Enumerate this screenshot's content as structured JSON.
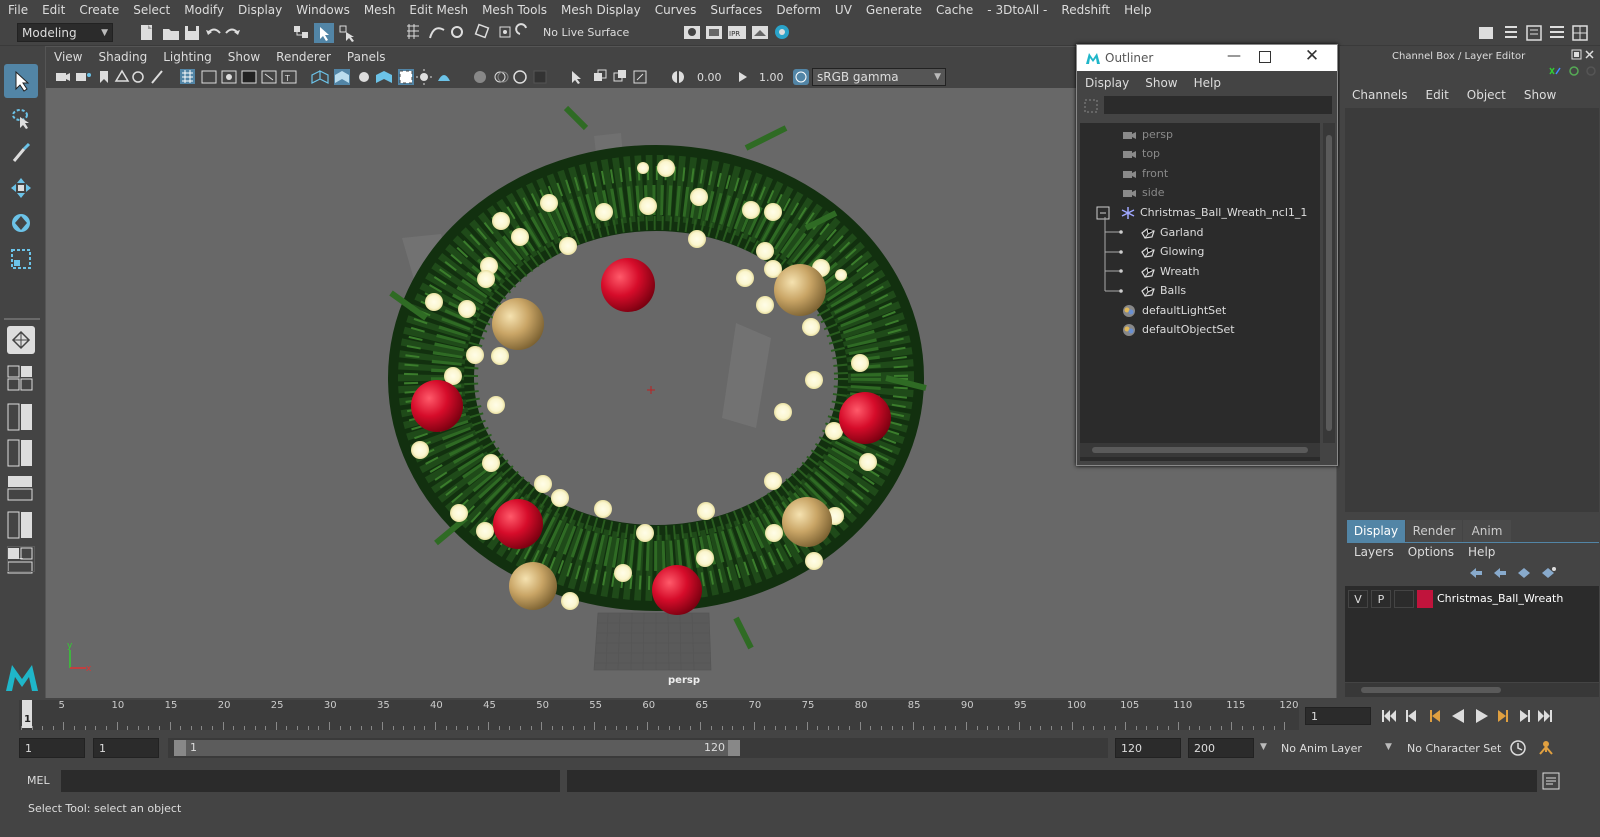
{
  "menu": [
    "File",
    "Edit",
    "Create",
    "Select",
    "Modify",
    "Display",
    "Windows",
    "Mesh",
    "Edit Mesh",
    "Mesh Tools",
    "Mesh Display",
    "Curves",
    "Surfaces",
    "Deform",
    "UV",
    "Generate",
    "Cache",
    "- 3DtoAll -",
    "Redshift",
    "Help"
  ],
  "status": {
    "workspace": "Modeling",
    "live_surface": "No Live Surface"
  },
  "viewport": {
    "menu": [
      "View",
      "Shading",
      "Lighting",
      "Show",
      "Renderer",
      "Panels"
    ],
    "exposure": "0.00",
    "gamma": "1.00",
    "colorspace": "sRGB gamma",
    "camera_label": "persp"
  },
  "outliner": {
    "title": "Outliner",
    "menu": [
      "Display",
      "Show",
      "Help"
    ],
    "items": [
      {
        "label": "persp",
        "type": "camera",
        "dim": true,
        "indent": 0
      },
      {
        "label": "top",
        "type": "camera",
        "dim": true,
        "indent": 0
      },
      {
        "label": "front",
        "type": "camera",
        "dim": true,
        "indent": 0
      },
      {
        "label": "side",
        "type": "camera",
        "dim": true,
        "indent": 0
      },
      {
        "label": "Christmas_Ball_Wreath_ncl1_1",
        "type": "group",
        "dim": false,
        "indent": 0
      },
      {
        "label": "Garland",
        "type": "mesh",
        "dim": false,
        "indent": 1
      },
      {
        "label": "Glowing",
        "type": "mesh",
        "dim": false,
        "indent": 1
      },
      {
        "label": "Wreath",
        "type": "mesh",
        "dim": false,
        "indent": 1
      },
      {
        "label": "Balls",
        "type": "mesh",
        "dim": false,
        "indent": 1
      },
      {
        "label": "defaultLightSet",
        "type": "set",
        "dim": false,
        "indent": 0
      },
      {
        "label": "defaultObjectSet",
        "type": "set",
        "dim": false,
        "indent": 0
      }
    ]
  },
  "channelbox": {
    "title": "Channel Box / Layer Editor",
    "menu": [
      "Channels",
      "Edit",
      "Object",
      "Show"
    ],
    "tabs": [
      "Display",
      "Render",
      "Anim"
    ],
    "layer_menu": [
      "Layers",
      "Options",
      "Help"
    ],
    "layer": {
      "v": "V",
      "p": "P",
      "name": "Christmas_Ball_Wreath",
      "color": "#c0143c"
    }
  },
  "timeline": {
    "ticks": [
      "5",
      "10",
      "15",
      "20",
      "25",
      "30",
      "35",
      "40",
      "45",
      "50",
      "55",
      "60",
      "65",
      "70",
      "75",
      "80",
      "85",
      "90",
      "95",
      "100",
      "105",
      "110",
      "115",
      "120"
    ],
    "start_marker": "1",
    "current_frame": "1"
  },
  "range": {
    "start": "1",
    "playback_start": "1",
    "slider_start": "1",
    "slider_end": "120",
    "playback_end": "120",
    "end": "200",
    "anim_layer": "No Anim Layer",
    "character_set": "No Character Set"
  },
  "command": {
    "lang": "MEL"
  },
  "help": {
    "text": "Select Tool: select an object"
  },
  "colors": {
    "accent": "#5285a6",
    "viewport_bg": "#686868",
    "panel": "#444444",
    "field": "#2b2b2b"
  }
}
